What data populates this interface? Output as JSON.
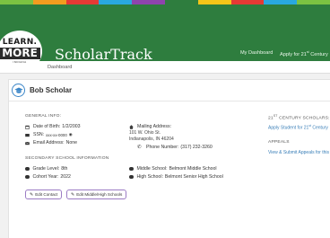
{
  "colors": {
    "topbar": "#2e7d3e",
    "stripe": [
      "#7cc242",
      "#f39c1f",
      "#e53935",
      "#29a8df",
      "#8e44ad",
      "#2e7d3e",
      "#f5c518",
      "#e53935",
      "#29a8df",
      "#7cc242"
    ],
    "link": "#3a7fb8",
    "button_border": "#9c7cc4"
  },
  "logo": {
    "line1": "LEARN.",
    "line2": "MORE",
    "line3": "INDIANA"
  },
  "header": {
    "brand": "ScholarTrack",
    "nav": [
      {
        "label": "My Dashboard"
      },
      {
        "label_prefix": "Apply for 21",
        "label_sup": "st",
        "label_suffix": " Century"
      }
    ]
  },
  "breadcrumb": {
    "label": "Dashboard"
  },
  "student": {
    "name": "Bob Scholar"
  },
  "general_info": {
    "heading": "GENERAL INFO:",
    "dob_label": "Date of Birth:",
    "dob_value": "1/2/2003",
    "ssn_label": "SSN:",
    "ssn_value": "xxx-xx-0000",
    "email_label": "Email Address:",
    "email_value": "None",
    "mailing_label": "Mailing Address:",
    "mailing_line1": "101 W. Ohio St.",
    "mailing_line2": "Indianapolis, IN 46204",
    "phone_label": "Phone Number:",
    "phone_value": "(317) 232-3260"
  },
  "secondary": {
    "heading": "SECONDARY SCHOOL INFORMATION",
    "grade_label": "Grade Level:",
    "grade_value": "8th",
    "cohort_label": "Cohort Year:",
    "cohort_value": "2022",
    "middle_label": "Middle School:",
    "middle_value": "Belmont Middle School",
    "high_label": "High School:",
    "high_value": "Belmont Senior High School"
  },
  "buttons": {
    "edit_contact": "Edit Contact",
    "edit_schools": "Edit Middle/High Schools"
  },
  "right_panel": {
    "scholars_heading_prefix": "21",
    "scholars_heading_sup": "ST",
    "scholars_heading_suffix": " CENTURY SCHOLARS:",
    "apply_link_prefix": "Apply Student for 21",
    "apply_link_sup": "st",
    "apply_link_suffix": " Century",
    "appeals_heading": "APPEALS",
    "appeals_link": "View & Submit Appeals for this"
  }
}
